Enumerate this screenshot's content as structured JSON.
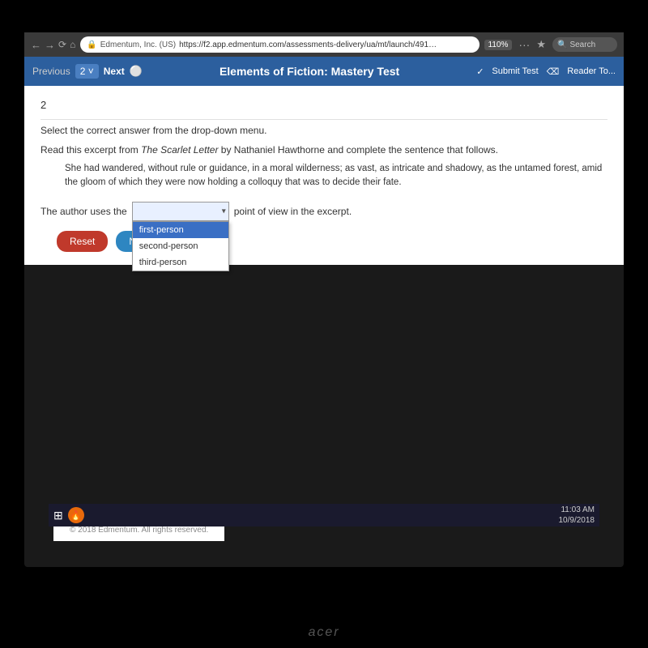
{
  "browser": {
    "security_icon": "🔒",
    "site_name": "Edmentum, Inc. (US)",
    "url": "https://f2.app.edmentum.com/assessments-delivery/ua/mt/launch/49100819/8530708",
    "zoom": "110%",
    "search_placeholder": "Search",
    "more_icon": "···"
  },
  "header": {
    "previous_label": "Previous",
    "question_number": "2",
    "chevron": "˅",
    "next_label": "Next",
    "settings_icon": "⚙",
    "title": "Elements of Fiction: Mastery Test",
    "submit_label": "Submit Test",
    "reader_label": "Reader To..."
  },
  "question": {
    "number": "2",
    "instruction": "Select the correct answer from the drop-down menu.",
    "excerpt_intro": "Read this excerpt from The Scarlet Letter by Nathaniel Hawthorne and complete the sentence that follows.",
    "excerpt_text": "She had wandered, without rule or guidance, in a moral wilderness; as vast, as intricate and shadowy, as the untamed forest, amid the gloom of which they were now holding a colloquy that was to decide their fate.",
    "question_prefix": "The author uses the",
    "question_suffix": "point of view in the excerpt.",
    "dropdown_selected": "",
    "dropdown_options": [
      {
        "value": "first-person",
        "label": "first-person"
      },
      {
        "value": "second-person",
        "label": "second-person"
      },
      {
        "value": "third-person",
        "label": "third-person"
      }
    ],
    "reset_label": "Reset",
    "next_label": "Next"
  },
  "footer": {
    "copyright": "© 2018 Edmentum. All rights reserved."
  },
  "taskbar": {
    "time": "11:03 AM",
    "date": "10/9/2018"
  }
}
